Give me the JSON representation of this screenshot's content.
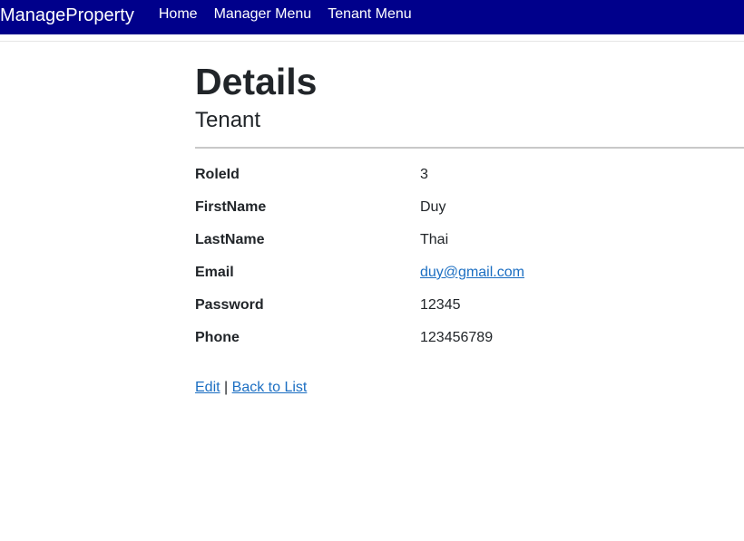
{
  "navbar": {
    "brand": "ManageProperty",
    "links": [
      "Home",
      "Manager Menu",
      "Tenant Menu"
    ]
  },
  "page": {
    "title": "Details",
    "subtitle": "Tenant"
  },
  "details": [
    {
      "label": "RoleId",
      "value": "3"
    },
    {
      "label": "FirstName",
      "value": "Duy"
    },
    {
      "label": "LastName",
      "value": "Thai"
    },
    {
      "label": "Email",
      "value": "duy@gmail.com"
    },
    {
      "label": "Password",
      "value": "12345"
    },
    {
      "label": "Phone",
      "value": "123456789"
    }
  ],
  "actions": {
    "edit": "Edit",
    "separator": "|",
    "back": "Back to List"
  },
  "colors": {
    "navbar": "#00008b",
    "link": "#1b6ec2",
    "text": "#212529"
  }
}
